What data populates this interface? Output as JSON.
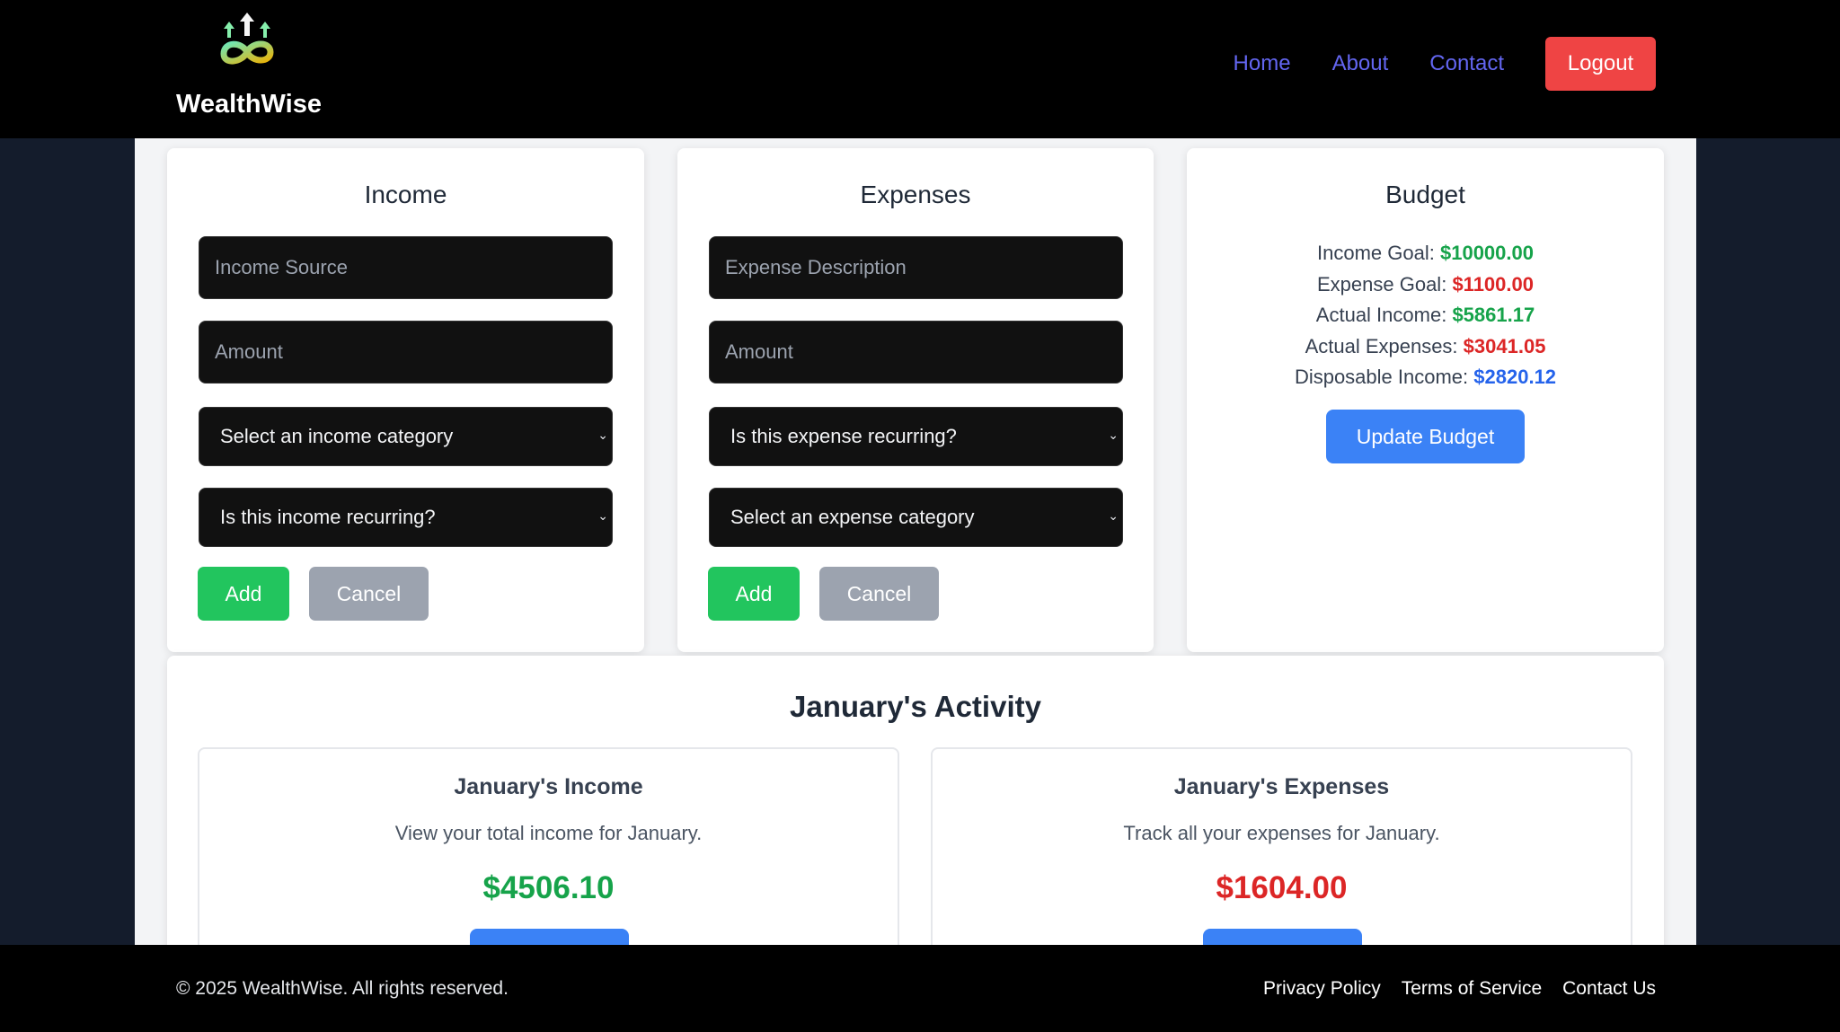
{
  "header": {
    "brand": "WealthWise",
    "nav": {
      "home": "Home",
      "about": "About",
      "contact": "Contact"
    },
    "logout": "Logout"
  },
  "income": {
    "title": "Income",
    "source_placeholder": "Income Source",
    "amount_placeholder": "Amount",
    "category_select": "Select an income category",
    "recurring_select": "Is this income recurring?",
    "add": "Add",
    "cancel": "Cancel"
  },
  "expenses": {
    "title": "Expenses",
    "description_placeholder": "Expense Description",
    "amount_placeholder": "Amount",
    "recurring_select": "Is this expense recurring?",
    "category_select": "Select an expense category",
    "add": "Add",
    "cancel": "Cancel"
  },
  "budget": {
    "title": "Budget",
    "income_goal_label": "Income Goal:",
    "income_goal": "$10000.00",
    "expense_goal_label": "Expense Goal:",
    "expense_goal": "$1100.00",
    "actual_income_label": "Actual Income:",
    "actual_income": "$5861.17",
    "actual_expenses_label": "Actual Expenses:",
    "actual_expenses": "$3041.05",
    "disposable_label": "Disposable Income:",
    "disposable": "$2820.12",
    "update": "Update Budget"
  },
  "activity": {
    "title": "January's Activity",
    "income": {
      "title": "January's Income",
      "desc": "View your total income for January.",
      "amount": "$4506.10"
    },
    "expenses": {
      "title": "January's Expenses",
      "desc": "Track all your expenses for January.",
      "amount": "$1604.00"
    }
  },
  "footer": {
    "copyright": "© 2025 WealthWise. All rights reserved.",
    "privacy": "Privacy Policy",
    "terms": "Terms of Service",
    "contact": "Contact Us"
  },
  "colors": {
    "positive": "#16a34a",
    "negative": "#dc2626",
    "primary": "#3b82f6",
    "logout": "#ef4444"
  }
}
